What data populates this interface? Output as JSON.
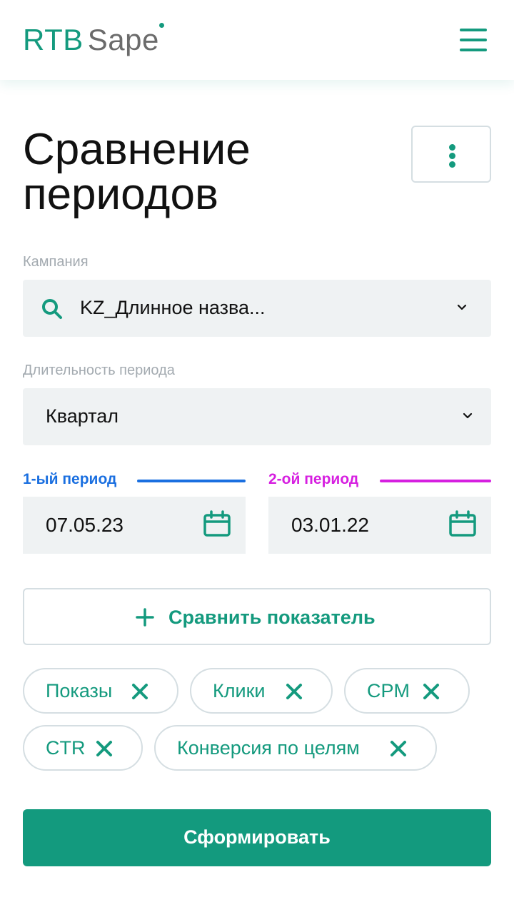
{
  "header": {
    "logo_primary": "RTB",
    "logo_secondary": "Sape",
    "menu_icon": "hamburger-menu-icon",
    "brand_color": "#149a7e"
  },
  "page": {
    "title_line1": "Сравнение",
    "title_line2": "периодов",
    "more_icon": "vertical-dots-icon"
  },
  "campaign": {
    "label": "Кампания",
    "value": "KZ_Длинное назва...",
    "icon": "search-icon"
  },
  "duration": {
    "label": "Длительность периода",
    "value": "Квартал"
  },
  "periods": [
    {
      "label": "1-ый период",
      "date": "07.05.23",
      "color": "#1a6fe0",
      "icon": "calendar-icon"
    },
    {
      "label": "2-ой период",
      "date": "03.01.22",
      "color": "#d61fe0",
      "icon": "calendar-icon"
    }
  ],
  "compare_button": {
    "label": "Сравнить показатель",
    "icon": "plus-icon"
  },
  "metrics": [
    {
      "label": "Показы"
    },
    {
      "label": "Клики"
    },
    {
      "label": "CPM"
    },
    {
      "label": "CTR"
    },
    {
      "label": "Конверсия по целям"
    }
  ],
  "submit_button": {
    "label": "Сформировать",
    "color": "#139a7e"
  }
}
